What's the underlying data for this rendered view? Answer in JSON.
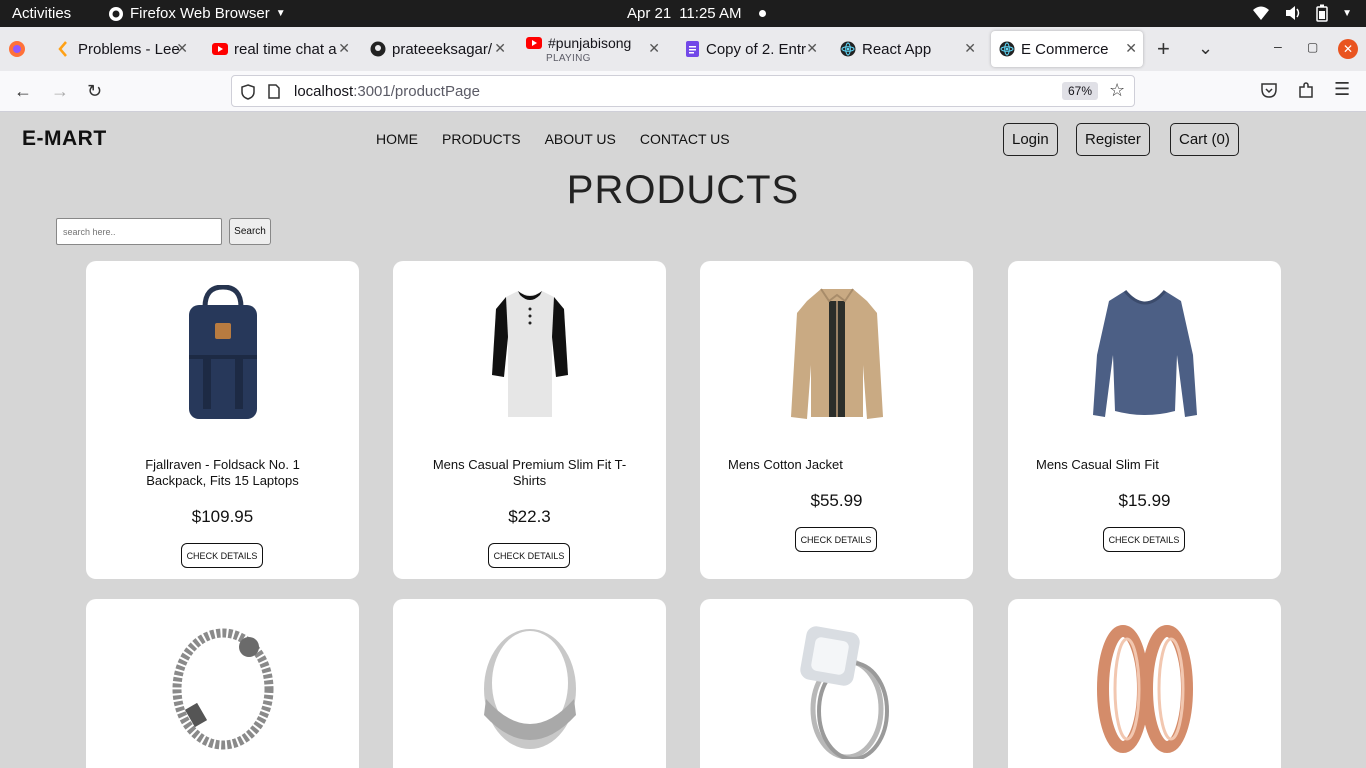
{
  "system_bar": {
    "activities": "Activities",
    "app": "Firefox Web Browser",
    "date": "Apr 21",
    "time": "11:25 AM"
  },
  "tabs": [
    {
      "title": "Problems - Lee",
      "icon": "leetcode-icon"
    },
    {
      "title": "real time chat a",
      "icon": "youtube-icon"
    },
    {
      "title": "prateeeksagar/",
      "icon": "github-icon"
    },
    {
      "title": "#punjabisong",
      "subtitle": "PLAYING",
      "icon": "youtube-icon"
    },
    {
      "title": "Copy of 2. Entr",
      "icon": "docs-icon"
    },
    {
      "title": "React App",
      "icon": "react-icon"
    },
    {
      "title": "E Commerce",
      "icon": "react-icon",
      "active": true
    }
  ],
  "address": {
    "host": "localhost",
    "path": ":3001/productPage",
    "zoom": "67%"
  },
  "site": {
    "brand": "E-MART",
    "menu": [
      "HOME",
      "PRODUCTS",
      "ABOUT US",
      "CONTACT US"
    ],
    "login": "Login",
    "register": "Register",
    "cart": "Cart (0)"
  },
  "page": {
    "title": "PRODUCTS",
    "search_placeholder": "search here..",
    "search_button": "Search"
  },
  "products": [
    {
      "name": "Fjallraven - Foldsack No. 1 Backpack, Fits 15 Laptops",
      "price": "$109.95",
      "button": "CHECK DETAILS",
      "image": "backpack"
    },
    {
      "name": "Mens Casual Premium Slim Fit T-Shirts",
      "price": "$22.3",
      "button": "CHECK DETAILS",
      "image": "tshirt"
    },
    {
      "name": "Mens Cotton Jacket",
      "price": "$55.99",
      "button": "CHECK DETAILS",
      "image": "jacket"
    },
    {
      "name": "Mens Casual Slim Fit",
      "price": "$15.99",
      "button": "CHECK DETAILS",
      "image": "longsleeve"
    },
    {
      "image": "bracelet"
    },
    {
      "image": "ring"
    },
    {
      "image": "diamond-ring"
    },
    {
      "image": "rose-gold-rings"
    }
  ],
  "colors": {
    "page_bg": "#d6d6d6",
    "card_bg": "#ffffff",
    "topbar": "#1d1d1d"
  }
}
